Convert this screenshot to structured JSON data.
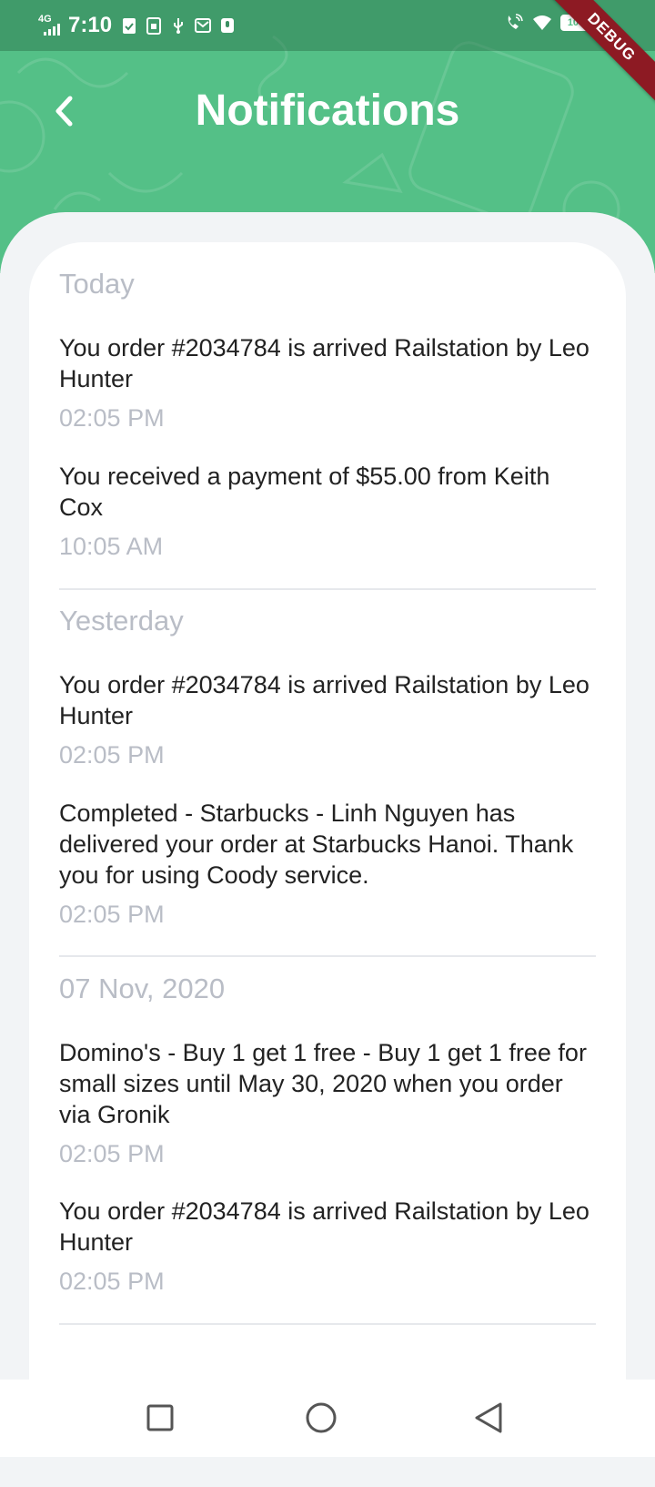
{
  "status_bar": {
    "network": "4G",
    "time": "7:10",
    "battery": "100"
  },
  "debug_banner": "DEBUG",
  "header": {
    "title": "Notifications"
  },
  "groups": [
    {
      "label": "Today",
      "items": [
        {
          "text": "You order #2034784 is arrived Railstation by Leo Hunter",
          "time": "02:05 PM"
        },
        {
          "text": "You received a payment of $55.00 from Keith Cox",
          "time": "10:05 AM"
        }
      ]
    },
    {
      "label": "Yesterday",
      "items": [
        {
          "text": "You order #2034784 is arrived Railstation by Leo Hunter",
          "time": "02:05 PM"
        },
        {
          "text": "Completed - Starbucks - Linh Nguyen has delivered your order at Starbucks Hanoi. Thank you for using Coody service.",
          "time": "02:05 PM"
        }
      ]
    },
    {
      "label": "07 Nov, 2020",
      "items": [
        {
          "text": "Domino's - Buy 1 get 1 free - Buy 1 get 1 free for small sizes until May 30, 2020 when you order via Gronik",
          "time": "02:05 PM"
        },
        {
          "text": "You order #2034784 is arrived Railstation by Leo Hunter",
          "time": "02:05 PM"
        }
      ]
    }
  ],
  "colors": {
    "header_green": "#54c087",
    "muted_text": "#b9bdc6",
    "body_text": "#222222",
    "debug_red": "#8d1a23"
  },
  "icons": {
    "back": "chevron-left-icon",
    "nav_recents": "square-icon",
    "nav_home": "circle-icon",
    "nav_back": "triangle-back-icon"
  }
}
